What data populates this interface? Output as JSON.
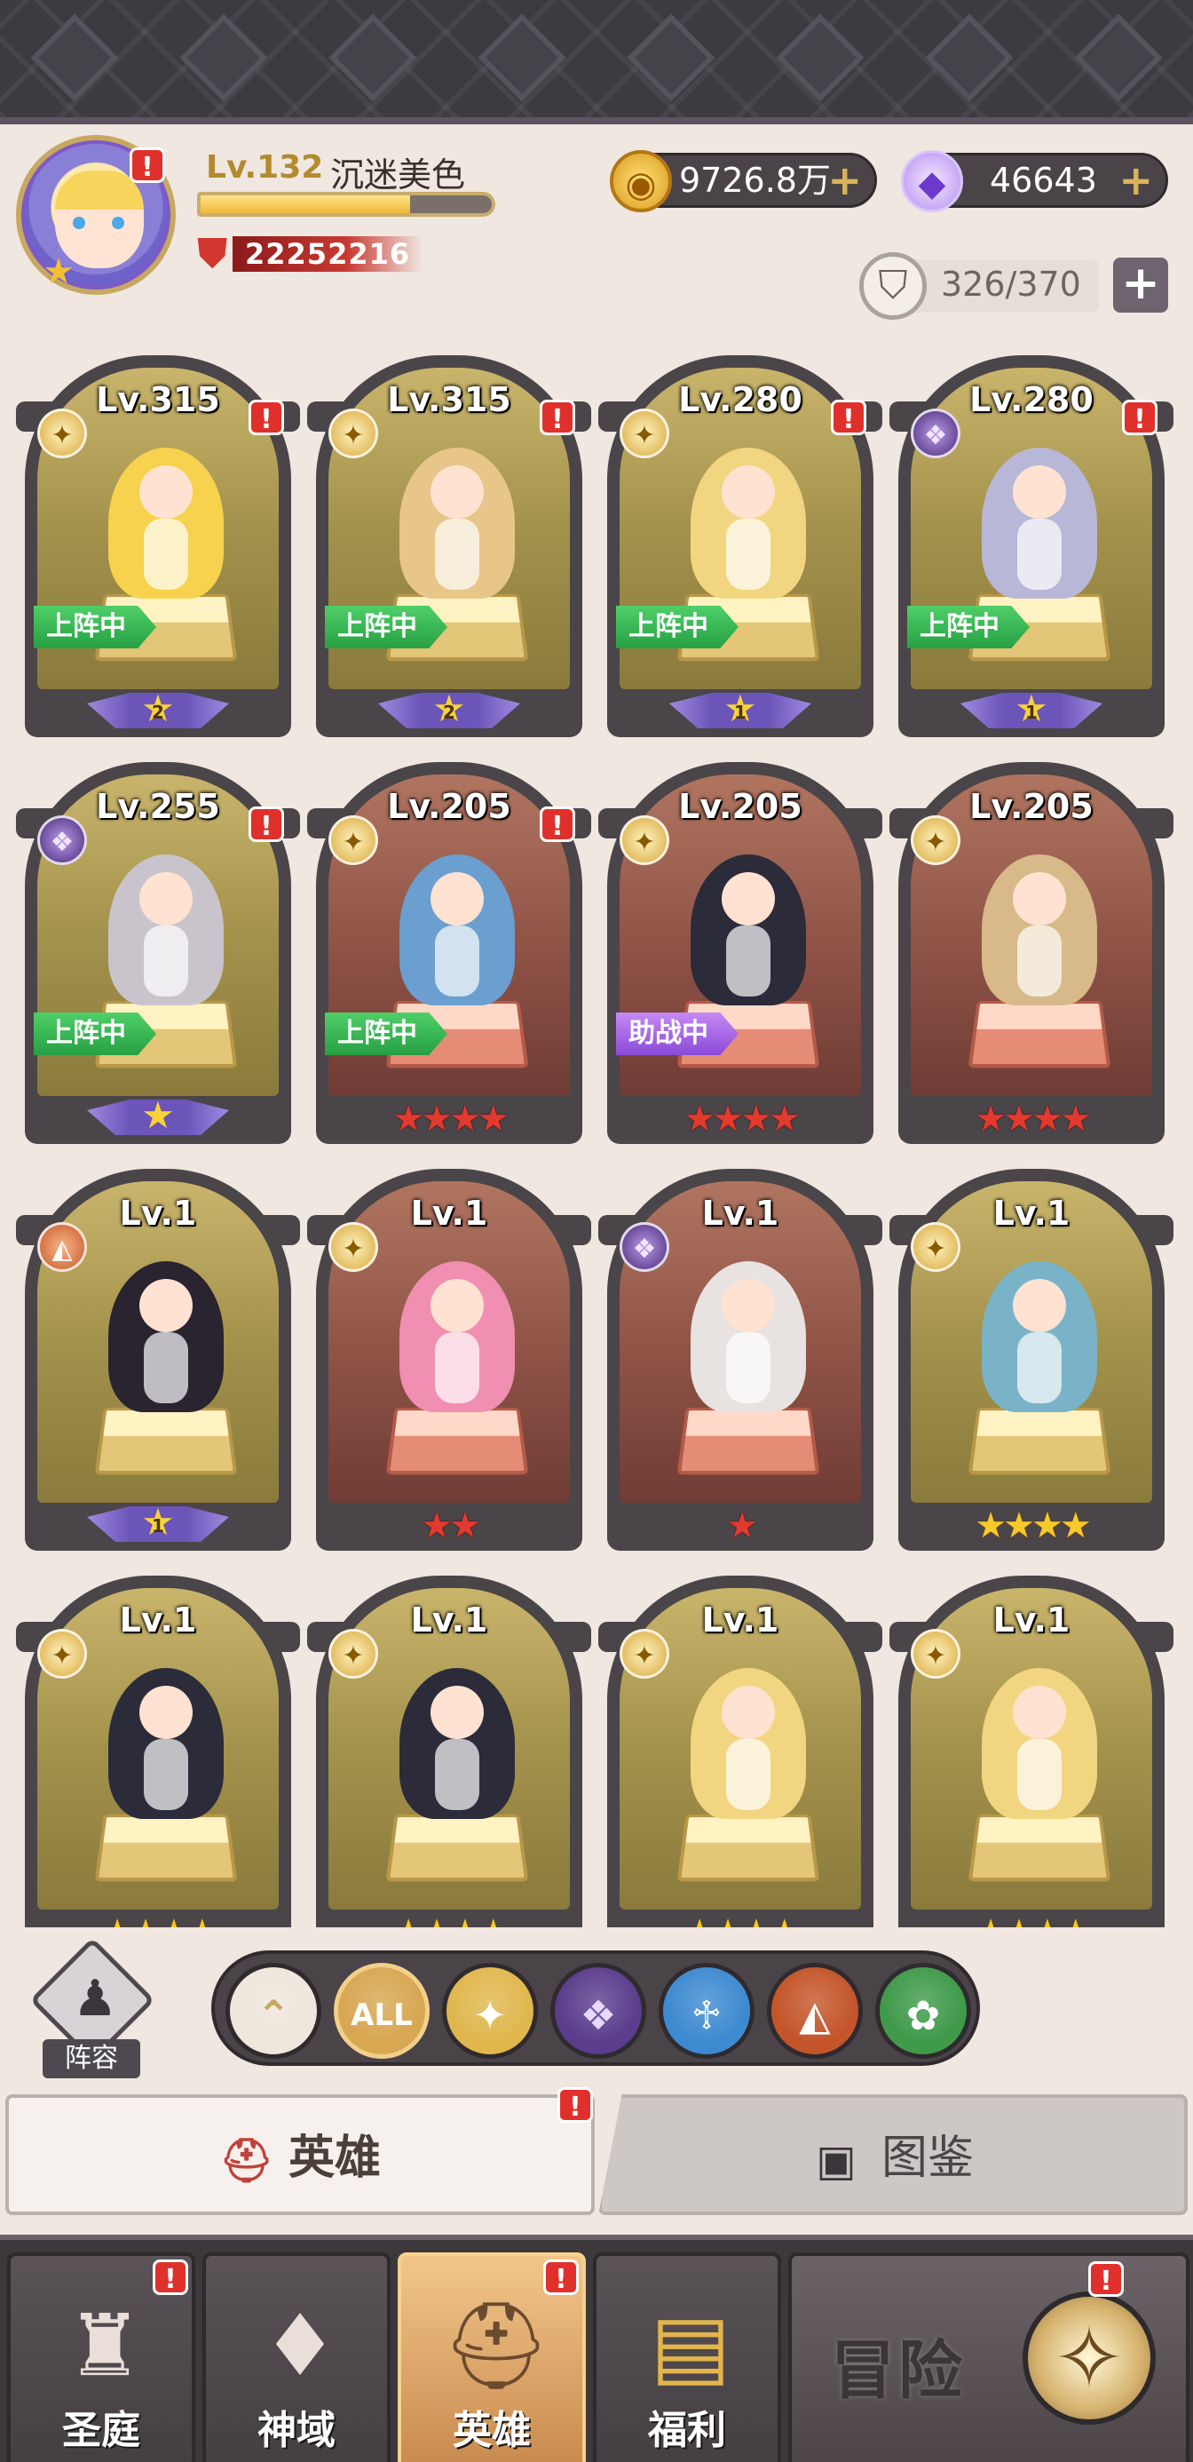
{
  "player": {
    "level": "Lv.132",
    "name": "沉迷美色",
    "exp_fraction": 0.72,
    "power": "22252216"
  },
  "currencies": {
    "gold": "9726.8万",
    "gems": "46643",
    "stamina": "326/370"
  },
  "icons": {
    "plus": "+",
    "alert": "!",
    "star": "★"
  },
  "heroes": [
    {
      "level": "Lv.315",
      "faction": "light",
      "alert": true,
      "status": "上阵中",
      "status_type": "deploy",
      "rank": "purple",
      "rank_num": "2",
      "bg": "gold"
    },
    {
      "level": "Lv.315",
      "faction": "light",
      "alert": true,
      "status": "上阵中",
      "status_type": "deploy",
      "rank": "purple",
      "rank_num": "2",
      "bg": "gold"
    },
    {
      "level": "Lv.280",
      "faction": "light",
      "alert": true,
      "status": "上阵中",
      "status_type": "deploy",
      "rank": "purple",
      "rank_num": "1",
      "bg": "gold"
    },
    {
      "level": "Lv.280",
      "faction": "dark",
      "alert": true,
      "status": "上阵中",
      "status_type": "deploy",
      "rank": "purple",
      "rank_num": "1",
      "bg": "gold"
    },
    {
      "level": "Lv.255",
      "faction": "dark",
      "alert": true,
      "status": "上阵中",
      "status_type": "deploy",
      "rank": "purple",
      "rank_num": "",
      "bg": "gold"
    },
    {
      "level": "Lv.205",
      "faction": "light",
      "alert": true,
      "status": "上阵中",
      "status_type": "deploy",
      "rank": "red",
      "rank_num": "4",
      "bg": "red"
    },
    {
      "level": "Lv.205",
      "faction": "light",
      "alert": false,
      "status": "助战中",
      "status_type": "assist",
      "rank": "red",
      "rank_num": "4",
      "bg": "red"
    },
    {
      "level": "Lv.205",
      "faction": "light",
      "alert": false,
      "status": "",
      "status_type": "",
      "rank": "red",
      "rank_num": "4",
      "bg": "red"
    },
    {
      "level": "Lv.1",
      "faction": "beast",
      "alert": false,
      "status": "",
      "status_type": "",
      "rank": "purple",
      "rank_num": "1",
      "bg": "gold"
    },
    {
      "level": "Lv.1",
      "faction": "light",
      "alert": false,
      "status": "",
      "status_type": "",
      "rank": "red",
      "rank_num": "2",
      "bg": "red"
    },
    {
      "level": "Lv.1",
      "faction": "dark",
      "alert": false,
      "status": "",
      "status_type": "",
      "rank": "red",
      "rank_num": "1",
      "bg": "red"
    },
    {
      "level": "Lv.1",
      "faction": "light",
      "alert": false,
      "status": "",
      "status_type": "",
      "rank": "gold",
      "rank_num": "4",
      "bg": "gold"
    },
    {
      "level": "Lv.1",
      "faction": "light",
      "alert": false,
      "status": "",
      "status_type": "",
      "rank": "gold",
      "rank_num": "4",
      "bg": "gold"
    },
    {
      "level": "Lv.1",
      "faction": "light",
      "alert": false,
      "status": "",
      "status_type": "",
      "rank": "gold",
      "rank_num": "4",
      "bg": "gold"
    },
    {
      "level": "Lv.1",
      "faction": "light",
      "alert": false,
      "status": "",
      "status_type": "",
      "rank": "gold",
      "rank_num": "4",
      "bg": "gold"
    },
    {
      "level": "Lv.1",
      "faction": "light",
      "alert": false,
      "status": "",
      "status_type": "",
      "rank": "gold",
      "rank_num": "4",
      "bg": "gold"
    }
  ],
  "lineup_label": "阵容",
  "filters": [
    {
      "name": "filter-up-icon",
      "glyph": "⌃",
      "color": "#efe6dc",
      "fg": "#c9a862"
    },
    {
      "name": "filter-all",
      "glyph": "ALL",
      "color": "#d7a752",
      "fg": "#ffffff"
    },
    {
      "name": "filter-light-icon",
      "glyph": "✦",
      "color": "#e0b74d",
      "fg": "#ffffff"
    },
    {
      "name": "filter-dark-icon",
      "glyph": "❖",
      "color": "#5a3d8c",
      "fg": "#e6d8ff"
    },
    {
      "name": "filter-holy-icon",
      "glyph": "♱",
      "color": "#3d8ad0",
      "fg": "#ffffff"
    },
    {
      "name": "filter-beast-icon",
      "glyph": "◭",
      "color": "#c4552a",
      "fg": "#ffffff"
    },
    {
      "name": "filter-nature-icon",
      "glyph": "✿",
      "color": "#3f9a4a",
      "fg": "#ffffff"
    }
  ],
  "tabs": {
    "heroes": "英雄",
    "codex": "图鉴"
  },
  "nav": {
    "court": "圣庭",
    "divine": "神域",
    "heroes": "英雄",
    "welfare": "福利",
    "adventure": "冒险"
  }
}
